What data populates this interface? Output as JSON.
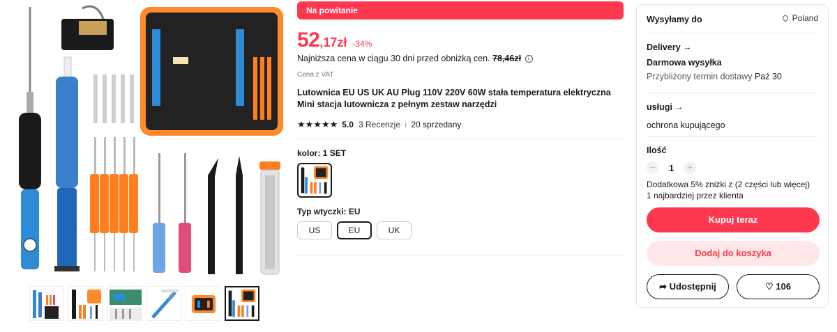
{
  "banner": {
    "welcome": "Na powitanie"
  },
  "price": {
    "integer": "52",
    "decimal": ",17zł",
    "discount": "-34%",
    "lowest_text": "Najniższa cena w ciągu 30 dni przed obniżką cen.",
    "lowest_value": "78,46zł",
    "vat": "Cena z VAT"
  },
  "product": {
    "title": "Lutownica EU US UK AU Plug 110V 220V 60W stała temperatura elektryczna Mini stacja lutownicza z pełnym zestaw narzędzi",
    "stars": "★★★★★",
    "rating": "5.0",
    "reviews": "3 Recenzje",
    "sold": "20 sprzedany"
  },
  "variants": {
    "color_label": "kolor:",
    "color_value": "1 SET",
    "plug_label": "Typ wtyczki:",
    "plug_value": "EU",
    "plug_options": [
      "US",
      "EU",
      "UK"
    ]
  },
  "panel": {
    "ship_to": "Wysyłamy do",
    "country": "Poland",
    "delivery_title": "Delivery",
    "free_shipping": "Darmowa wysyłka",
    "eta_prefix": "Przybliżony termin dostawy",
    "eta_date": "Paź 30",
    "services_title": "usługi",
    "protection": "ochrona kupującego",
    "qty_title": "Ilość",
    "qty_value": "1",
    "promo": "Dodatkowa 5% zniżki z (2 części lub więcej)",
    "promo_limit": "1 najbardziej przez klienta",
    "buy_now": "Kupuj teraz",
    "add_to_cart": "Dodaj do koszyka",
    "share": "Udostępnij",
    "likes": "106"
  },
  "colors": {
    "accent": "#fd384f",
    "accent_light": "#ffe7e9",
    "text": "#191919"
  }
}
